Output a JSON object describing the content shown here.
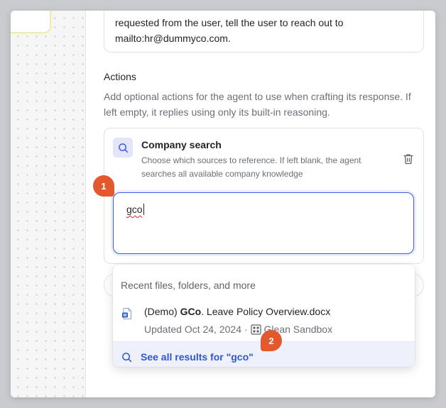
{
  "instructions": {
    "text_line1": "requested from the user, tell the user to reach out to",
    "text_line2": "mailto:hr@dummyco.com."
  },
  "actions": {
    "title": "Actions",
    "description": "Add optional actions for the agent to use when crafting its response. If left empty, it replies using only its built-in reasoning.",
    "card": {
      "icon": "search-icon",
      "title": "Company search",
      "description": "Choose which sources to reference. If left blank, the agent searches all available company knowledge",
      "delete_icon": "trash-icon"
    }
  },
  "search": {
    "value": "gco"
  },
  "dropdown": {
    "header": "Recent files, folders, and more",
    "results": [
      {
        "icon": "word-doc-icon",
        "prefix": "(Demo) ",
        "match": "GCo",
        "suffix": ". Leave Policy Overview.docx",
        "updated": "Updated Oct 24, 2024 ·",
        "source_icon": "datasource-icon",
        "source": "Glean Sandbox"
      }
    ],
    "see_all_label": "See all results for \"gco\""
  },
  "badges": {
    "step1": "1",
    "step2": "2",
    "color": "#e4582e"
  },
  "colors": {
    "accent": "#3d5ce0",
    "link": "#2f55d4",
    "highlight_bg": "#eef1fc"
  }
}
